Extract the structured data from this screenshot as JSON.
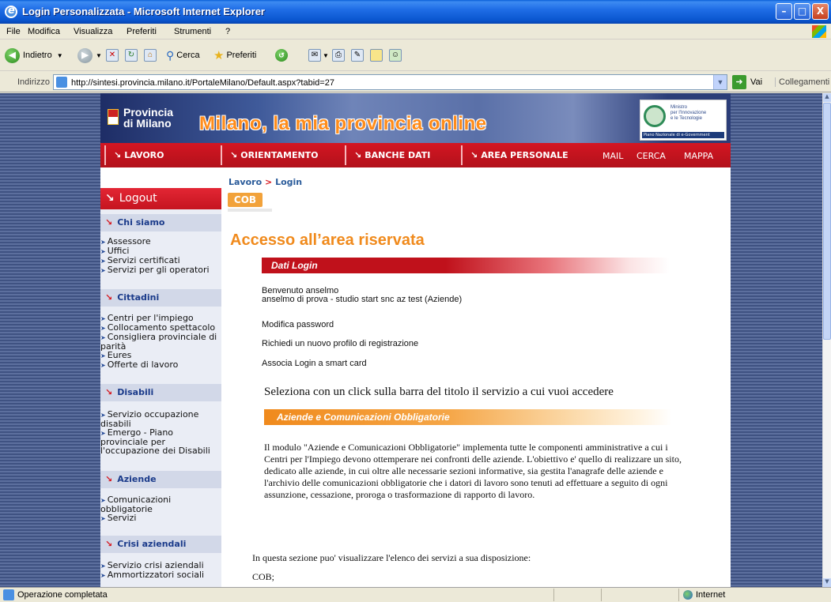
{
  "window": {
    "title": "Login Personalizzata - Microsoft Internet Explorer",
    "minimize": "–",
    "maximize": "□",
    "close": "X"
  },
  "menu": [
    "File",
    "Modifica",
    "Visualizza",
    "Preferiti",
    "Strumenti",
    "?"
  ],
  "toolbar": {
    "back": "Indietro",
    "search": "Cerca",
    "favorites": "Preferiti"
  },
  "address": {
    "label": "Indirizzo",
    "url": "http://sintesi.provincia.milano.it/PortaleMilano/Default.aspx?tabid=27",
    "go": "Vai",
    "links": "Collegamenti"
  },
  "banner": {
    "province_line1": "Provincia",
    "province_line2": "di Milano",
    "slogan": "Milano, la mia provincia online",
    "ministry_line1": "Ministro",
    "ministry_line2": "per l'Innovazione",
    "ministry_line3": "e le Tecnologie",
    "ministry_bar": "Piano Nazionale di e-Government"
  },
  "nav": {
    "items": [
      "LAVORO",
      "ORIENTAMENTO",
      "BANCHE DATI",
      "AREA PERSONALE"
    ],
    "mail": "MAIL",
    "cerca": "CERCA",
    "mappa": "MAPPA"
  },
  "breadcrumb": {
    "first": "Lavoro",
    "sep": ">",
    "second": "Login"
  },
  "cob_tab": "COB",
  "sidebar": {
    "logout": "Logout",
    "sections": [
      {
        "title": "Chi siamo",
        "links": [
          "Assessore",
          "Uffici",
          "Servizi certificati",
          "Servizi per gli operatori"
        ]
      },
      {
        "title": "Cittadini",
        "links": [
          "Centri per l'impiego",
          "Collocamento spettacolo",
          "Consigliera provinciale di parità",
          "Eures",
          "Offerte di lavoro"
        ]
      },
      {
        "title": "Disabili",
        "links": [
          "Servizio occupazione disabili",
          "Emergo - Piano provinciale per l'occupazione dei Disabili"
        ]
      },
      {
        "title": "Aziende",
        "links": [
          "Comunicazioni obbligatorie",
          "Servizi"
        ]
      },
      {
        "title": "Crisi aziendali",
        "links": [
          "Servizio crisi aziendali",
          "Ammortizzatori sociali"
        ]
      }
    ]
  },
  "main": {
    "title": "Accesso all’area riservata",
    "dati_login": "Dati Login",
    "welcome": "Benvenuto anselmo",
    "user_info": "anselmo di prova - studio start snc az test (Aziende)",
    "modifica_password": "Modifica password",
    "nuovo_profilo": "Richiedi un nuovo profilo di registrazione",
    "smart_card": "Associa Login a smart card",
    "seleziona": "Seleziona con un click sulla barra del titolo il servizio a cui vuoi accedere",
    "aziende_bar": "Aziende e Comunicazioni Obbligatorie",
    "description": "Il modulo \"Aziende e Comunicazioni Obbligatorie\" implementa tutte le componenti amministrative a cui i Centri per l'Impiego devono ottemperare nei confronti delle aziende. L'obiettivo e' quello di realizzare un sito, dedicato alle aziende, in cui oltre alle necessarie sezioni informative, sia gestita l'anagrafe delle aziende e l'archivio delle comunicazioni obbligatorie che i datori di lavoro sono tenuti ad effettuare a seguito di ogni assunzione, cessazione, proroga o trasformazione di rapporto di lavoro.",
    "intro": "In questa sezione puo' visualizzare l'elenco dei servizi a sua disposizione:",
    "cob_item": "COB;"
  },
  "status": {
    "text": "Operazione completata",
    "zone": "Internet"
  }
}
